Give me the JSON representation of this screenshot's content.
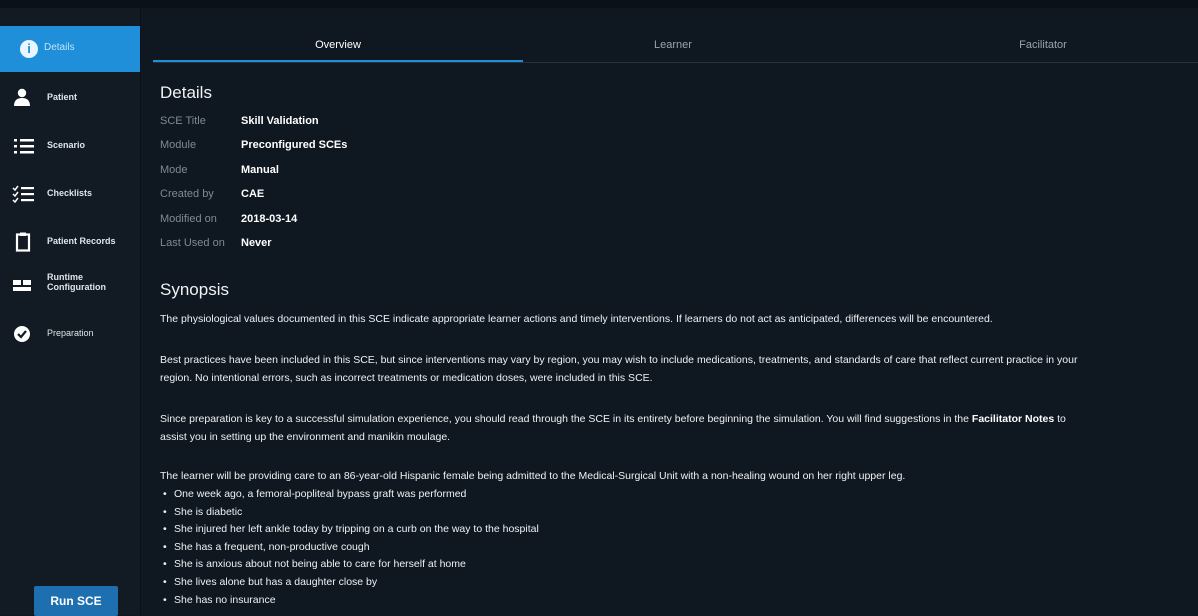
{
  "sidebar": {
    "active_label": "Details",
    "items": [
      {
        "label": "Patient",
        "icon": "person-icon"
      },
      {
        "label": "Scenario",
        "icon": "list-icon"
      },
      {
        "label": "Checklists",
        "icon": "checklist-icon"
      },
      {
        "label": "Patient Records",
        "icon": "clipboard-icon"
      },
      {
        "label_line1": "Runtime",
        "label_line2": "Configuration",
        "icon": "runtime-config-icon"
      },
      {
        "label": "Preparation",
        "icon": "check-circle-icon"
      }
    ],
    "run_button": "Run SCE"
  },
  "tabs": [
    {
      "label": "Overview",
      "active": true
    },
    {
      "label": "Learner",
      "active": false
    },
    {
      "label": "Facilitator",
      "active": false
    }
  ],
  "details": {
    "heading": "Details",
    "rows": [
      {
        "key": "SCE Title",
        "value": "Skill Validation"
      },
      {
        "key": "Module",
        "value": "Preconfigured SCEs"
      },
      {
        "key": "Mode",
        "value": "Manual"
      },
      {
        "key": "Created by",
        "value": "CAE"
      },
      {
        "key": "Modified on",
        "value": "2018-03-14"
      },
      {
        "key": "Last Used on",
        "value": "Never"
      }
    ]
  },
  "synopsis": {
    "heading": "Synopsis",
    "p1": "The physiological values documented in this SCE indicate appropriate learner actions and timely interventions. If learners do not act as anticipated, differences will be encountered.",
    "p2_line1": "Best practices have been included in this SCE, but since interventions may vary by region, you may wish to include medications, treatments, and standards of care that reflect current practice in your",
    "p2_line2": "region. No intentional errors, such as incorrect treatments or medication doses, were included in this SCE.",
    "p3_line1_a": "Since preparation is key to a successful simulation experience, you should read through the SCE in its entirety before beginning the simulation. You will find suggestions in the ",
    "p3_line1_bold": "Facilitator Notes",
    "p3_line1_b": " to",
    "p3_line2": "assist you in setting up the environment and manikin moulage.",
    "p4": "The learner will be providing care to an 86-year-old Hispanic female being admitted to the Medical-Surgical Unit with a non-healing wound on her right upper leg.",
    "bullets": [
      "One week ago, a femoral-popliteal bypass graft was performed",
      "She is diabetic",
      "She injured her left ankle today by tripping on a curb on the way to the hospital",
      "She has a frequent, non-productive cough",
      "She is anxious about not being able to care for herself at home",
      "She lives alone but has a daughter close by",
      "She has no insurance"
    ]
  },
  "colors": {
    "accent": "#1e8fd8",
    "background": "#0f1720",
    "sidebar": "#121b24",
    "button": "#1d6fb0"
  }
}
